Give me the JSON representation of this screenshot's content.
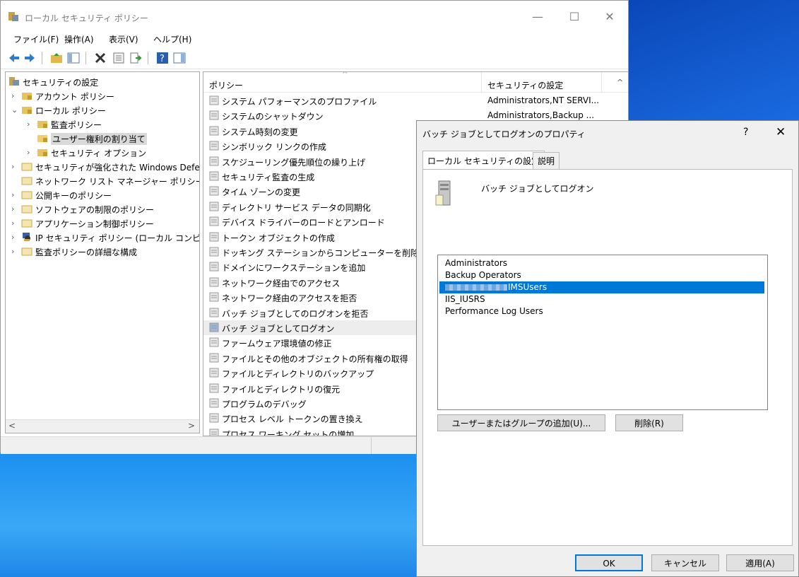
{
  "main_window": {
    "title": "ローカル セキュリティ ポリシー",
    "controls": {
      "minimize": "—",
      "maximize": "☐",
      "close": "✕"
    },
    "menu": [
      "ファイル(F)",
      "操作(A)",
      "表示(V)",
      "ヘルプ(H)"
    ]
  },
  "tree": {
    "items": [
      {
        "label": "セキュリティの設定",
        "expander": "",
        "level": 0
      },
      {
        "label": "アカウント ポリシー",
        "expander": "›",
        "level": 1
      },
      {
        "label": "ローカル ポリシー",
        "expander": "⌄",
        "level": 1
      },
      {
        "label": "監査ポリシー",
        "expander": "›",
        "level": 2
      },
      {
        "label": "ユーザー権利の割り当て",
        "expander": "",
        "level": 2,
        "selected": true
      },
      {
        "label": "セキュリティ オプション",
        "expander": "›",
        "level": 2
      },
      {
        "label": "セキュリティが強化された Windows Defer",
        "expander": "›",
        "level": 1
      },
      {
        "label": "ネットワーク リスト マネージャー ポリシー",
        "expander": "",
        "level": 1
      },
      {
        "label": "公開キーのポリシー",
        "expander": "›",
        "level": 1
      },
      {
        "label": "ソフトウェアの制限のポリシー",
        "expander": "›",
        "level": 1
      },
      {
        "label": "アプリケーション制御ポリシー",
        "expander": "›",
        "level": 1
      },
      {
        "label": "IP セキュリティ ポリシー (ローカル コンピュータ",
        "expander": "›",
        "level": 1
      },
      {
        "label": "監査ポリシーの詳細な構成",
        "expander": "›",
        "level": 1
      }
    ]
  },
  "list": {
    "col_policy": "ポリシー",
    "col_setting": "セキュリティの設定",
    "rows": [
      {
        "name": "システム パフォーマンスのプロファイル",
        "value": "Administrators,NT SERVI..."
      },
      {
        "name": "システムのシャットダウン",
        "value": "Administrators,Backup ..."
      },
      {
        "name": "システム時刻の変更",
        "value": ""
      },
      {
        "name": "シンボリック リンクの作成",
        "value": ""
      },
      {
        "name": "スケジューリング優先順位の繰り上げ",
        "value": ""
      },
      {
        "name": "セキュリティ監査の生成",
        "value": ""
      },
      {
        "name": "タイム ゾーンの変更",
        "value": ""
      },
      {
        "name": "ディレクトリ サービス データの同期化",
        "value": ""
      },
      {
        "name": "デバイス ドライバーのロードとアンロード",
        "value": ""
      },
      {
        "name": "トークン オブジェクトの作成",
        "value": ""
      },
      {
        "name": "ドッキング ステーションからコンピューターを削除",
        "value": ""
      },
      {
        "name": "ドメインにワークステーションを追加",
        "value": ""
      },
      {
        "name": "ネットワーク経由でのアクセス",
        "value": ""
      },
      {
        "name": "ネットワーク経由のアクセスを拒否",
        "value": ""
      },
      {
        "name": "バッチ ジョブとしてのログオンを拒否",
        "value": ""
      },
      {
        "name": "バッチ ジョブとしてログオン",
        "value": "",
        "highlight": true
      },
      {
        "name": "ファームウェア環境値の修正",
        "value": ""
      },
      {
        "name": "ファイルとその他のオブジェクトの所有権の取得",
        "value": ""
      },
      {
        "name": "ファイルとディレクトリのバックアップ",
        "value": ""
      },
      {
        "name": "ファイルとディレクトリの復元",
        "value": ""
      },
      {
        "name": "プログラムのデバッグ",
        "value": ""
      },
      {
        "name": "プロセス レベル トークンの置き換え",
        "value": ""
      },
      {
        "name": "プロセス ワーキング セットの増加",
        "value": ""
      }
    ]
  },
  "dialog": {
    "title": "バッチ ジョブとしてログオンのプロパティ",
    "help": "?",
    "close": "✕",
    "tabs": [
      "ローカル セキュリティの設定",
      "説明"
    ],
    "policy_name": "バッチ ジョブとしてログオン",
    "members": [
      {
        "name": "Administrators"
      },
      {
        "name": "Backup Operators"
      },
      {
        "name": "IMSUsers",
        "selected": true
      },
      {
        "name": "IIS_IUSRS"
      },
      {
        "name": "Performance Log Users"
      }
    ],
    "add_button": "ユーザーまたはグループの追加(U)...",
    "remove_button": "削除(R)",
    "ok_button": "OK",
    "cancel_button": "キャンセル",
    "apply_button": "適用(A)"
  }
}
